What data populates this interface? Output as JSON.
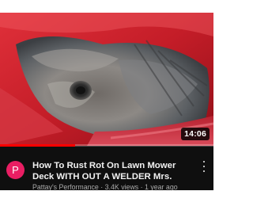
{
  "video": {
    "duration": "14:06",
    "watched_fraction": 0.35,
    "title": "How To Rust Rot On Lawn Mower\nDeck WITH OUT A WELDER Mrs. Pa...",
    "channel": "Pattay's Performance",
    "views": "3.4K views",
    "age": "1 year ago",
    "separator": " · "
  },
  "avatar": {
    "letter": "P",
    "color": "#e91e63"
  },
  "colors": {
    "background": "#0f0f0f",
    "progress": "#ff0000",
    "title_text": "#f1f1f1",
    "secondary_text": "#aaaaaa"
  },
  "icons": {
    "menu": "more-vert-icon"
  }
}
